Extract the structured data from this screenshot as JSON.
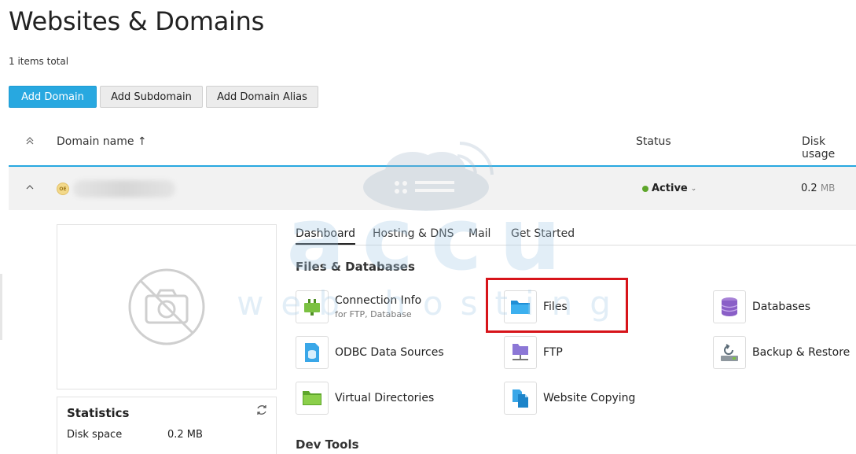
{
  "page": {
    "title": "Websites & Domains",
    "items_total": "1 items total"
  },
  "toolbar": {
    "add_domain": "Add Domain",
    "add_subdomain": "Add Subdomain",
    "add_domain_alias": "Add Domain Alias"
  },
  "table": {
    "columns": {
      "domain_name": "Domain name ↑",
      "status": "Status",
      "disk_usage": "Disk usage"
    },
    "row": {
      "favicon_text": "OE",
      "status": "Active",
      "disk_value": "0.2",
      "disk_unit": "MB"
    }
  },
  "stats": {
    "title": "Statistics",
    "disk_label": "Disk space",
    "disk_value": "0.2 MB"
  },
  "tabs": [
    {
      "label": "Dashboard",
      "active": true
    },
    {
      "label": "Hosting & DNS",
      "active": false
    },
    {
      "label": "Mail",
      "active": false
    },
    {
      "label": "Get Started",
      "active": false
    }
  ],
  "sections": {
    "files_databases": "Files & Databases",
    "dev_tools": "Dev Tools"
  },
  "tools": {
    "connection_info": {
      "label": "Connection Info",
      "sub": "for FTP, Database",
      "icon": "connection-icon"
    },
    "files": {
      "label": "Files",
      "icon": "folder-icon"
    },
    "databases": {
      "label": "Databases",
      "icon": "database-icon"
    },
    "odbc": {
      "label": "ODBC Data Sources",
      "icon": "odbc-icon"
    },
    "ftp": {
      "label": "FTP",
      "icon": "ftp-icon"
    },
    "backup": {
      "label": "Backup & Restore",
      "icon": "backup-icon"
    },
    "virtual_dirs": {
      "label": "Virtual Directories",
      "icon": "folder-green-icon"
    },
    "website_copying": {
      "label": "Website Copying",
      "icon": "copy-icon"
    }
  },
  "watermark": {
    "brand": "accu",
    "tagline": "web hosting"
  },
  "colors": {
    "accent": "#28a8e0",
    "status_active": "#5ea62b",
    "highlight": "#d7141a"
  }
}
